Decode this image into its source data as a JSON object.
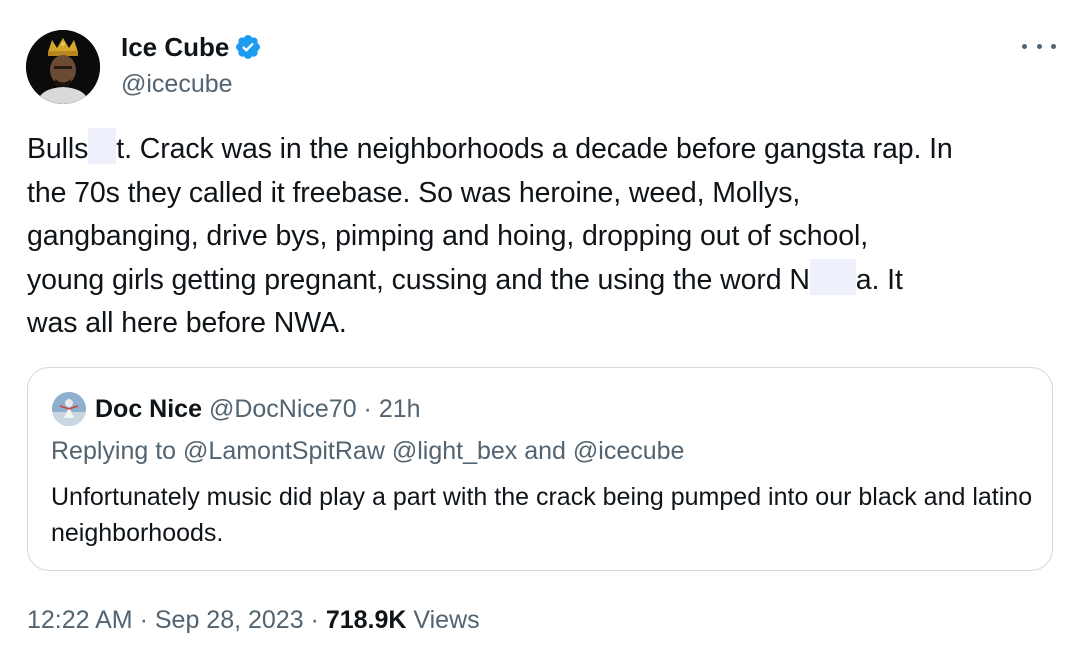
{
  "author": {
    "name": "Ice Cube",
    "handle": "@icecube",
    "verified": true
  },
  "tweet": {
    "lines": [
      [
        "Bulls",
        "t. Crack was in the neighborhoods a decade before gangsta rap. In"
      ],
      [
        "the 70s they called it freebase. So was heroine, weed, Mollys,"
      ],
      [
        "gangbanging, drive bys, pimping and hoing, dropping out of school,"
      ],
      [
        "young girls getting pregnant, cussing and the using the word N",
        "a. It"
      ],
      [
        "was all here before NWA."
      ]
    ]
  },
  "quote": {
    "name": "Doc Nice",
    "handle": "@DocNice70",
    "separator": " · ",
    "time": "21h",
    "replying_prefix": "Replying to ",
    "replying_handles": [
      "@LamontSpitRaw",
      "@light_bex"
    ],
    "replying_and": " and ",
    "replying_last": "@icecube",
    "text": "Unfortunately music did play a part with the crack being pumped into our black and latino neighborhoods."
  },
  "footer": {
    "time": "12:22 AM",
    "sep1": " · ",
    "date": "Sep 28, 2023",
    "sep2": " · ",
    "views_count": "718.9K",
    "views_label": " Views"
  },
  "colors": {
    "verified": "#1d9bf0",
    "secondary_text": "#536471",
    "primary_text": "#0f1419",
    "border": "#cfd9de"
  },
  "icons": {
    "verified": "verified-badge-icon",
    "more": "more-horizontal-icon"
  }
}
